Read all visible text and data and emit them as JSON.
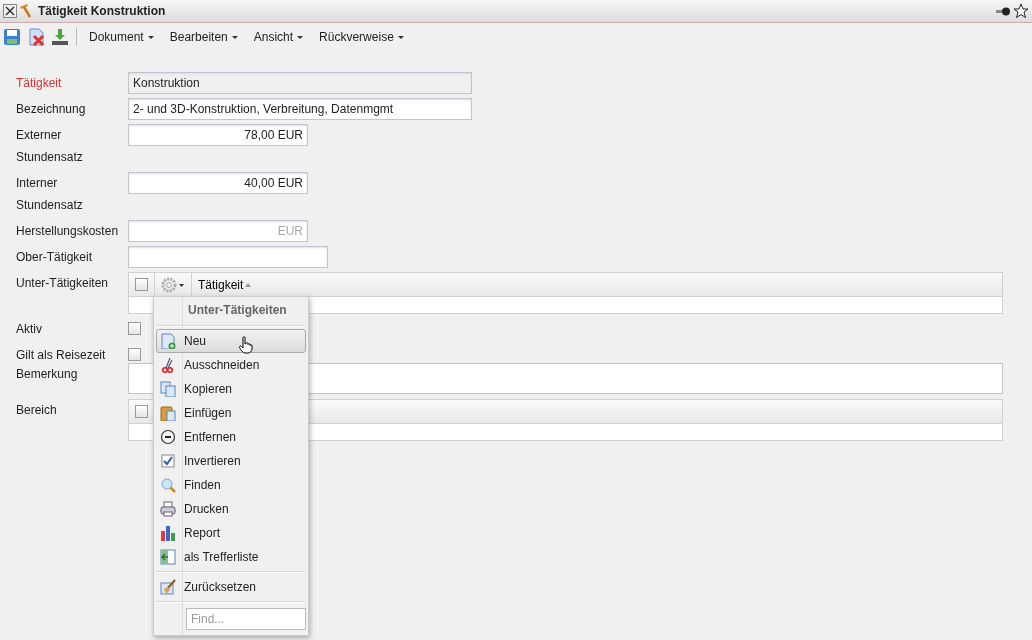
{
  "window": {
    "title": "Tätigkeit Konstruktion"
  },
  "toolbar": {
    "menus": [
      "Dokument",
      "Bearbeiten",
      "Ansicht",
      "Rückverweise"
    ]
  },
  "form": {
    "fields": [
      {
        "kind": "text",
        "label": "Tätigkeit",
        "value": "Konstruktion",
        "required": true,
        "readonly": true
      },
      {
        "kind": "text",
        "label": "Bezeichnung",
        "value": "2- und 3D-Konstruktion, Verbreitung, Datenmgmt",
        "required": false,
        "readonly": false
      },
      {
        "kind": "money",
        "label": "Externer Stundensatz",
        "value": "78,00 EUR"
      },
      {
        "kind": "money",
        "label": "Interner Stundensatz",
        "value": "40,00 EUR"
      },
      {
        "kind": "money",
        "label": "Herstellungskosten",
        "placeholder": "EUR"
      },
      {
        "kind": "lookup",
        "label": "Ober-Tätigkeit"
      },
      {
        "kind": "grid",
        "label": "Unter-Tätigkeiten",
        "header_checked": false,
        "columns": [
          {
            "label": "Tätigkeit",
            "sorted": true
          }
        ]
      },
      {
        "kind": "checkbox",
        "label": "Aktiv",
        "checked": false
      },
      {
        "kind": "checkbox",
        "label": "Gilt als Reisezeit",
        "checked": false
      },
      {
        "kind": "textarea",
        "label": "Bemerkung"
      },
      {
        "kind": "grid",
        "label": "Bereich",
        "header_checked": false
      }
    ]
  },
  "context_menu": {
    "title": "Unter-Tätigkeiten",
    "groups": [
      [
        {
          "label": "Neu",
          "selected": true
        },
        {
          "label": "Ausschneiden",
          "selected": false
        },
        {
          "label": "Kopieren",
          "selected": false
        },
        {
          "label": "Einfügen",
          "selected": false
        },
        {
          "label": "Entfernen",
          "selected": false
        },
        {
          "label": "Invertieren",
          "selected": false
        },
        {
          "label": "Finden",
          "selected": false
        },
        {
          "label": "Drucken",
          "selected": false
        },
        {
          "label": "Report",
          "selected": false
        },
        {
          "label": "als Trefferliste",
          "selected": false
        }
      ],
      [
        {
          "label": "Zurücksetzen",
          "selected": false
        }
      ]
    ],
    "search": {
      "placeholder": "Find..."
    }
  }
}
